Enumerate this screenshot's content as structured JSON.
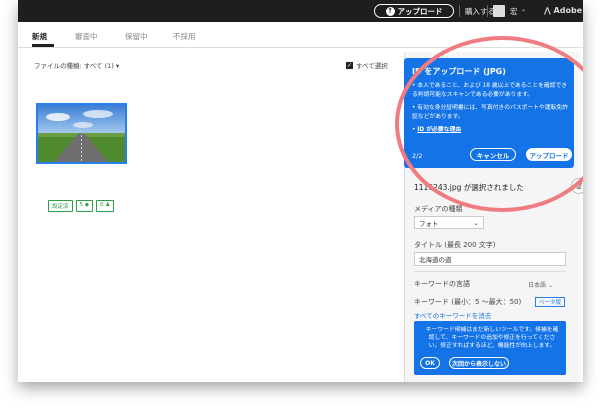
{
  "topbar": {
    "upload_label": "アップロード",
    "purchase_label": "購入する",
    "user_name": "宏",
    "brand": "Adobe"
  },
  "tabs": [
    "新規",
    "審査中",
    "保留中",
    "不採用"
  ],
  "filter": {
    "label": "ファイルの種類: すべて (1)"
  },
  "select_all_label": "すべて選択",
  "thumbnail": {
    "badges": [
      "設定済",
      "5",
      "0"
    ]
  },
  "popup": {
    "title": "ID をアップロード (JPG)",
    "bullet1": "本人であること、および 18 歳以上であることを確認できる判読可能なスキャンである必要があります。",
    "bullet2": "有効な身分証明書には、写真付きのパスポートや運転免許証などがあります。",
    "link": "ID が必要な理由",
    "step": "2/2",
    "cancel_label": "キャンセル",
    "upload_label": "アップロード"
  },
  "panel": {
    "selected_file": "1116243.jpg が選択されました",
    "media_type_label": "メディアの種類",
    "media_type_value": "フォト",
    "title_label": "タイトル (最長 200 文字)",
    "title_value": "北海道の道",
    "keyword_lang_label": "キーワードの言語",
    "keyword_lang_value": "日本語",
    "keywords_label": "キーワード (最小：5 〜最大：50)",
    "beta_label": "ベータ版",
    "clear_link": "すべてのキーワードを消去",
    "tip_text": "キーワード候補はまだ新しいツールです。候補を確認して、キーワードの追加や修正を行ってください。修正すればするほど、機能性が向上します。",
    "ok_label": "OK",
    "hide_label": "次回から表示しない"
  },
  "colors": {
    "accent": "#1473e6",
    "highlight_circle": "#f07c82",
    "topbar": "#1e1e1e",
    "badge": "#2d9d4a"
  }
}
